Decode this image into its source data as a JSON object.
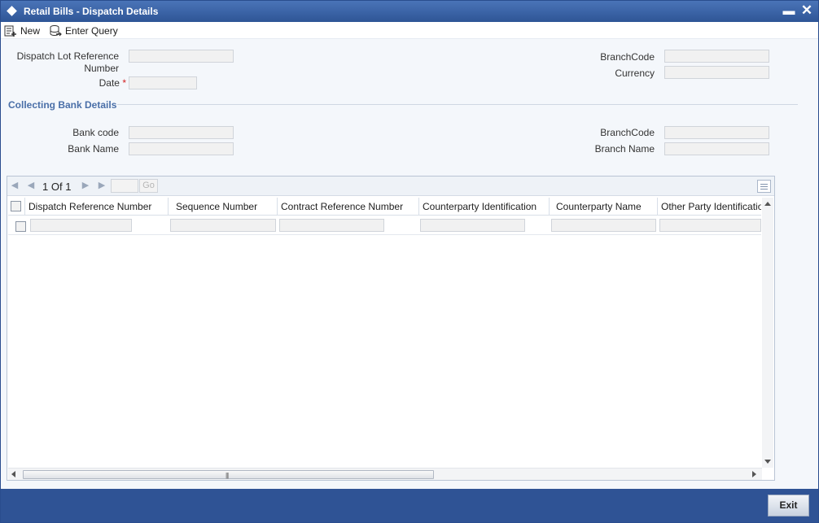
{
  "window": {
    "title": "Retail Bills - Dispatch Details",
    "minimize_glyph": "▬",
    "close_glyph": "✕"
  },
  "toolbar": {
    "new_label": "New",
    "enter_query_label": "Enter Query",
    "new_icon": "new-document-icon",
    "enter_query_icon": "query-icon"
  },
  "form": {
    "dispatch_lot_ref_label": "Dispatch Lot Reference Number",
    "dispatch_lot_ref_value": "",
    "date_label": "Date",
    "date_required_mark": "*",
    "date_value": "",
    "branch_code_label": "BranchCode",
    "branch_code_value": "",
    "currency_label": "Currency",
    "currency_value": ""
  },
  "collecting_bank": {
    "section_title": "Collecting Bank Details",
    "bank_code_label": "Bank code",
    "bank_code_value": "",
    "bank_name_label": "Bank Name",
    "bank_name_value": "",
    "branch_code_label": "BranchCode",
    "branch_code_value": "",
    "branch_name_label": "Branch Name",
    "branch_name_value": ""
  },
  "pager": {
    "current_page": "1",
    "of_label": "Of",
    "total_pages": "1",
    "page_input": "",
    "go_label": "Go"
  },
  "grid": {
    "columns": [
      "Dispatch Reference Number",
      "Sequence Number",
      "Contract Reference Number",
      "Counterparty Identification",
      "Counterparty Name",
      "Other Party Identificatio"
    ],
    "rows": [
      [
        "",
        "",
        "",
        "",
        "",
        ""
      ]
    ]
  },
  "footer": {
    "exit_label": "Exit"
  },
  "colors": {
    "title_bar": "#2e5596",
    "section_title": "#4a6fa8",
    "required": "#d21f1f",
    "footer": "#2f5395"
  }
}
